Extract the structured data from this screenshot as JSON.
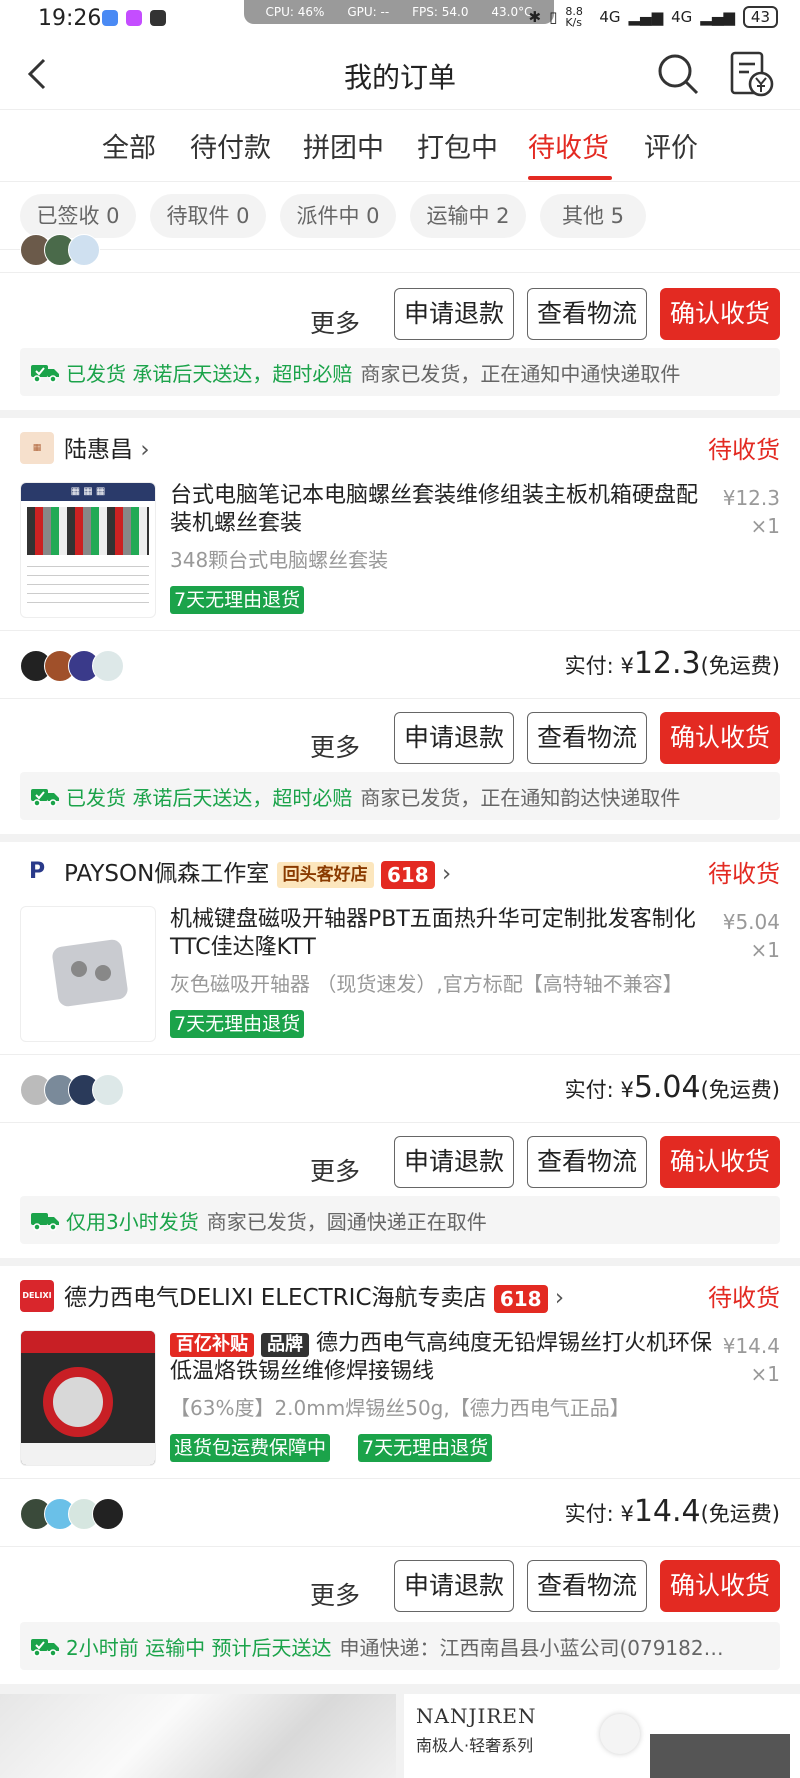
{
  "status_bar": {
    "time": "19:26",
    "perf": {
      "cpu": "CPU: 46%",
      "gpu": "GPU: --",
      "fps": "FPS: 54.0",
      "temp": "43.0°C"
    },
    "speed": "8.8 K/s",
    "net1": "4G",
    "net2": "4G",
    "battery": "43"
  },
  "header": {
    "title": "我的订单"
  },
  "tabs": [
    {
      "label": "全部"
    },
    {
      "label": "待付款"
    },
    {
      "label": "拼团中"
    },
    {
      "label": "打包中"
    },
    {
      "label": "待收货",
      "active": true
    },
    {
      "label": "评价"
    }
  ],
  "chips": [
    {
      "label": "已签收 0"
    },
    {
      "label": "待取件 0"
    },
    {
      "label": "派件中 0"
    },
    {
      "label": "运输中 2"
    },
    {
      "label": "其他 5"
    }
  ],
  "actions": {
    "more": "更多",
    "refund": "申请退款",
    "logistics": "查看物流",
    "confirm": "确认收货"
  },
  "orders": [
    {
      "ship_green": "已发货 承诺后天送达，超时必赔",
      "ship_text": "商家已发货，正在通知中通快递取件"
    },
    {
      "shop": "陆惠昌",
      "status": "待收货",
      "title": "台式电脑笔记本电脑螺丝套装维修组装主板机箱硬盘配装机螺丝套装",
      "spec": "348颗台式电脑螺丝套装",
      "tags": [
        "7天无理由退货"
      ],
      "price": "¥12.3",
      "qty": "×1",
      "paid_label": "实付: ",
      "paid_currency": "¥",
      "paid_amount": "12.3",
      "paid_note": "(免运费)",
      "ship_green": "已发货 承诺后天送达，超时必赔",
      "ship_text": "商家已发货，正在通知韵达快递取件"
    },
    {
      "shop": "PAYSON佩森工作室",
      "shop_badge": "回头客好店",
      "badge618": "618",
      "status": "待收货",
      "title": "机械键盘磁吸开轴器PBT五面热升华可定制批发客制化TTC佳达隆KTT",
      "spec": "灰色磁吸开轴器 （现货速发）,官方标配【高特轴不兼容】",
      "tags": [
        "7天无理由退货"
      ],
      "price": "¥5.04",
      "qty": "×1",
      "paid_label": "实付: ",
      "paid_currency": "¥",
      "paid_amount": "5.04",
      "paid_note": "(免运费)",
      "ship_green": "仅用3小时发货",
      "ship_text": "商家已发货，圆通快递正在取件"
    },
    {
      "shop": "德力西电气DELIXI ELECTRIC海航专卖店",
      "badge618": "618",
      "status": "待收货",
      "label_red": "百亿补贴",
      "label_dark": "品牌",
      "title": "德力西电气高纯度无铅焊锡丝打火机环保低温烙铁锡丝维修焊接锡线",
      "spec": "【63%度】2.0mm焊锡丝50g,【德力西电气正品】",
      "tags": [
        "退货包运费保障中",
        "7天无理由退货"
      ],
      "price": "¥14.4",
      "qty": "×1",
      "paid_label": "实付: ",
      "paid_currency": "¥",
      "paid_amount": "14.4",
      "paid_note": "(免运费)",
      "ship_green": "2小时前 运输中 预计后天送达",
      "ship_text": "申通快递：江西南昌县小蓝公司(079182…"
    }
  ],
  "recommend": {
    "brand": "NANJIREN",
    "sub": "南极人·轻奢系列"
  },
  "colors": {
    "accent": "#e32a22",
    "green": "#1ba34a"
  }
}
